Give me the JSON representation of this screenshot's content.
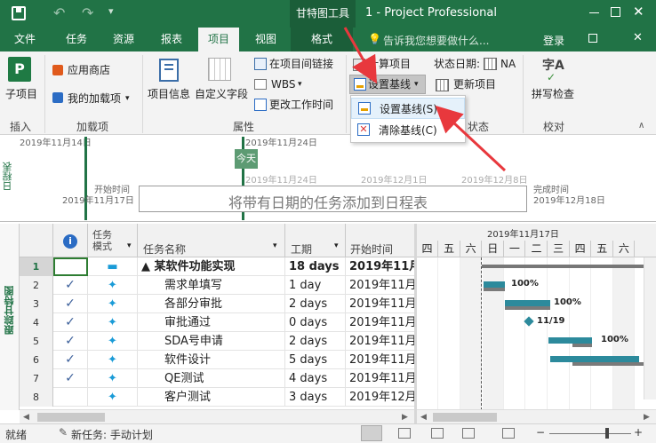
{
  "titlebar": {
    "context_tab": "甘特图工具",
    "title": "1 - Project Professional"
  },
  "tabs": [
    "文件",
    "任务",
    "资源",
    "报表",
    "项目",
    "视图",
    "格式"
  ],
  "tell_me": "告诉我您想要做什么...",
  "login": "登录",
  "ribbon": {
    "subproject": "子项目",
    "app_store": "应用商店",
    "my_addins": "我的加载项",
    "project_info": "项目信息",
    "custom_fields": "自定义字段",
    "link_between": "在项目间链接",
    "wbs": "WBS",
    "change_worktime": "更改工作时间",
    "calc_project": "计算项目",
    "set_baseline": "设置基线",
    "status_date_label": "状态日期:",
    "status_date": "NA",
    "update_project": "更新项目",
    "spell_check": "拼写检查",
    "groups": {
      "insert": "插入",
      "addins": "加载项",
      "properties": "属性",
      "status": "状态",
      "proofing": "校对"
    }
  },
  "menu": {
    "set_baseline": "设置基线(S)...",
    "clear_baseline": "清除基线(C)"
  },
  "timeline": {
    "side_label": "日程表",
    "top_dates": [
      "2019年11月14日",
      "2019年11月24日"
    ],
    "today": "今天",
    "scale_dates": [
      "2019年11月24日",
      "2019年12月1日",
      "2019年12月8日"
    ],
    "start_label": "开始时间",
    "start_date": "2019年11月17日",
    "finish_label": "完成时间",
    "finish_date": "2019年12月18日",
    "placeholder": "将带有日期的任务添加到日程表"
  },
  "grid": {
    "side_label": "跟踪甘特图",
    "headers": {
      "mode": "任务模式",
      "name": "任务名称",
      "duration": "工期",
      "start": "开始时间"
    },
    "rows": [
      {
        "id": "1",
        "name": "▲ 某软件功能实现",
        "duration": "18 days",
        "start": "2019年11月"
      },
      {
        "id": "2",
        "name": "需求单填写",
        "duration": "1 day",
        "start": "2019年11月"
      },
      {
        "id": "3",
        "name": "各部分审批",
        "duration": "2 days",
        "start": "2019年11月"
      },
      {
        "id": "4",
        "name": "审批通过",
        "duration": "0 days",
        "start": "2019年11月"
      },
      {
        "id": "5",
        "name": "SDA号申请",
        "duration": "2 days",
        "start": "2019年11月"
      },
      {
        "id": "6",
        "name": "软件设计",
        "duration": "5 days",
        "start": "2019年11月"
      },
      {
        "id": "7",
        "name": "QE测试",
        "duration": "4 days",
        "start": "2019年11月"
      },
      {
        "id": "8",
        "name": "客户测试",
        "duration": "3 days",
        "start": "2019年12月"
      }
    ]
  },
  "gantt": {
    "week_label": "2019年11月17日",
    "days": [
      "四",
      "五",
      "六",
      "日",
      "一",
      "二",
      "三",
      "四",
      "五",
      "六"
    ],
    "labels": [
      "100%",
      "100%",
      "11/19",
      "100%"
    ]
  },
  "status": {
    "ready": "就绪",
    "new_task": "新任务: 手动计划"
  },
  "colors": {
    "accent": "#217346",
    "bar_blue": "#2c8a9c",
    "bar_gray": "#7a7a7a",
    "arrow_red": "#e8383d"
  }
}
